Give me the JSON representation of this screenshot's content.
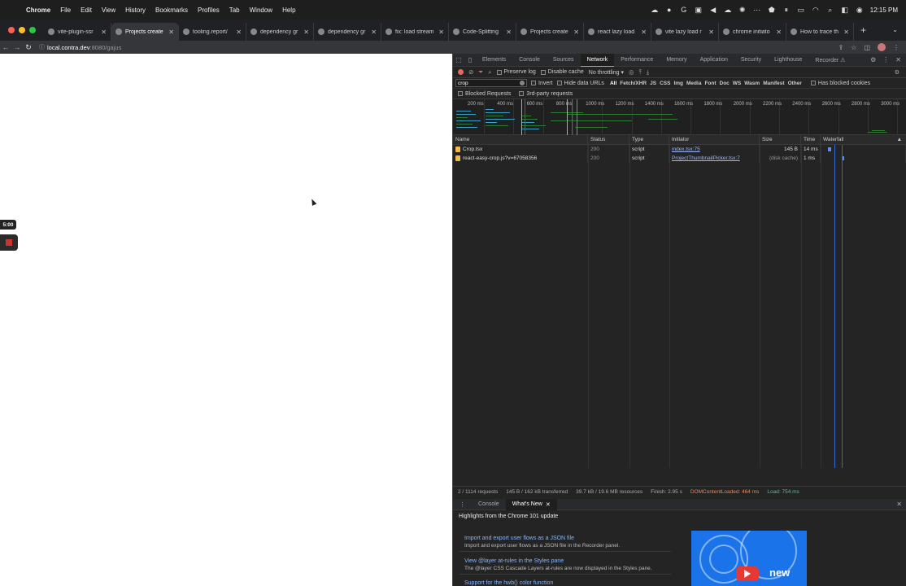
{
  "menubar": {
    "items": [
      "Chrome",
      "File",
      "Edit",
      "View",
      "History",
      "Bookmarks",
      "Profiles",
      "Tab",
      "Window",
      "Help"
    ],
    "clock": "12:15 PM"
  },
  "tabs": [
    {
      "title": "vite-plugin-ssr",
      "active": false
    },
    {
      "title": "Projects create",
      "active": true
    },
    {
      "title": "tooling.report/",
      "active": false
    },
    {
      "title": "dependency gr",
      "active": false
    },
    {
      "title": "dependency gr",
      "active": false
    },
    {
      "title": "fix: load stream",
      "active": false
    },
    {
      "title": "Code-Splitting",
      "active": false
    },
    {
      "title": "Projects create",
      "active": false
    },
    {
      "title": "react lazy load",
      "active": false
    },
    {
      "title": "vite lazy load r",
      "active": false
    },
    {
      "title": "chrome initiato",
      "active": false
    },
    {
      "title": "How to trace th",
      "active": false
    }
  ],
  "address": {
    "host": "local.contra.dev",
    "path": ":8080/gajus"
  },
  "recorder_overlay": {
    "timer": "5:00"
  },
  "devtools": {
    "panels": [
      "Elements",
      "Console",
      "Sources",
      "Network",
      "Performance",
      "Memory",
      "Application",
      "Security",
      "Lighthouse",
      "Recorder ⚠"
    ],
    "active_panel": "Network",
    "toolbar": {
      "preserve_log": "Preserve log",
      "disable_cache": "Disable cache",
      "throttling": "No throttling"
    },
    "filter": {
      "value": "crop",
      "invert": "Invert",
      "hide_data_urls": "Hide data URLs",
      "types": [
        "All",
        "Fetch/XHR",
        "JS",
        "CSS",
        "Img",
        "Media",
        "Font",
        "Doc",
        "WS",
        "Wasm",
        "Manifest",
        "Other"
      ],
      "has_blocked_cookies": "Has blocked cookies",
      "blocked_requests": "Blocked Requests",
      "third_party": "3rd-party requests"
    },
    "overview_ticks": [
      "200 ms",
      "400 ms",
      "600 ms",
      "800 ms",
      "1000 ms",
      "1200 ms",
      "1400 ms",
      "1600 ms",
      "1800 ms",
      "2000 ms",
      "2200 ms",
      "2400 ms",
      "2600 ms",
      "2800 ms",
      "3000 ms"
    ],
    "columns": [
      "Name",
      "Status",
      "Type",
      "Initiator",
      "Size",
      "Time",
      "Waterfall"
    ],
    "rows": [
      {
        "name": "Crop.tsx",
        "status": "200",
        "type": "script",
        "initiator": "index.tsx:75",
        "size": "145 B",
        "time": "14 ms"
      },
      {
        "name": "react-easy-crop.js?v=67058356",
        "status": "200",
        "type": "script",
        "initiator": "ProjectThumbnailPicker.tsx:7",
        "size": "(disk cache)",
        "time": "1 ms"
      }
    ],
    "summary": {
      "requests": "2 / 1114 requests",
      "transferred": "145 B / 162 kB transferred",
      "resources": "39.7 kB / 19.6 MB resources",
      "finish": "Finish: 2.95 s",
      "dcl": "DOMContentLoaded: 464 ms",
      "load": "Load: 754 ms"
    },
    "drawer": {
      "tabs": [
        "Console",
        "What's New"
      ],
      "active_tab": "What's New",
      "heading": "Highlights from the Chrome 101 update",
      "items": [
        {
          "title": "Import and export user flows as a JSON file",
          "desc": "Import and export user flows as a JSON file in the Recorder panel."
        },
        {
          "title": "View @layer at-rules in the Styles pane",
          "desc": "The @layer CSS Cascade Layers at-rules are now displayed in the Styles pane."
        },
        {
          "title": "Support for the hwb() color function",
          "desc": ""
        }
      ],
      "video_label": "new"
    }
  }
}
